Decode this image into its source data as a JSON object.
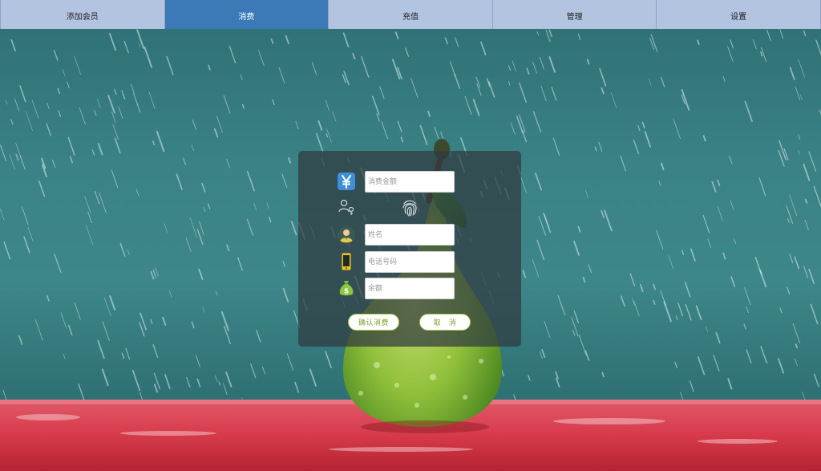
{
  "nav": {
    "tabs": [
      {
        "label": "添加会员",
        "active": false
      },
      {
        "label": "消费",
        "active": true
      },
      {
        "label": "充值",
        "active": false
      },
      {
        "label": "管理",
        "active": false
      },
      {
        "label": "设置",
        "active": false
      }
    ]
  },
  "form": {
    "amount_placeholder": "消费金额",
    "name_placeholder": "姓名",
    "phone_placeholder": "电话号码",
    "balance_placeholder": "余额",
    "confirm_label": "确认消费",
    "cancel_label": "取　消"
  },
  "icons": {
    "amount": "yen-icon",
    "member": "person-key-icon",
    "fingerprint": "fingerprint-icon",
    "name": "avatar-icon",
    "phone": "mobile-phone-icon",
    "balance": "money-bag-icon"
  },
  "colors": {
    "nav_bg": "#b3c4e0",
    "nav_active": "#3b7ab6",
    "button_text": "#7aa32a"
  }
}
